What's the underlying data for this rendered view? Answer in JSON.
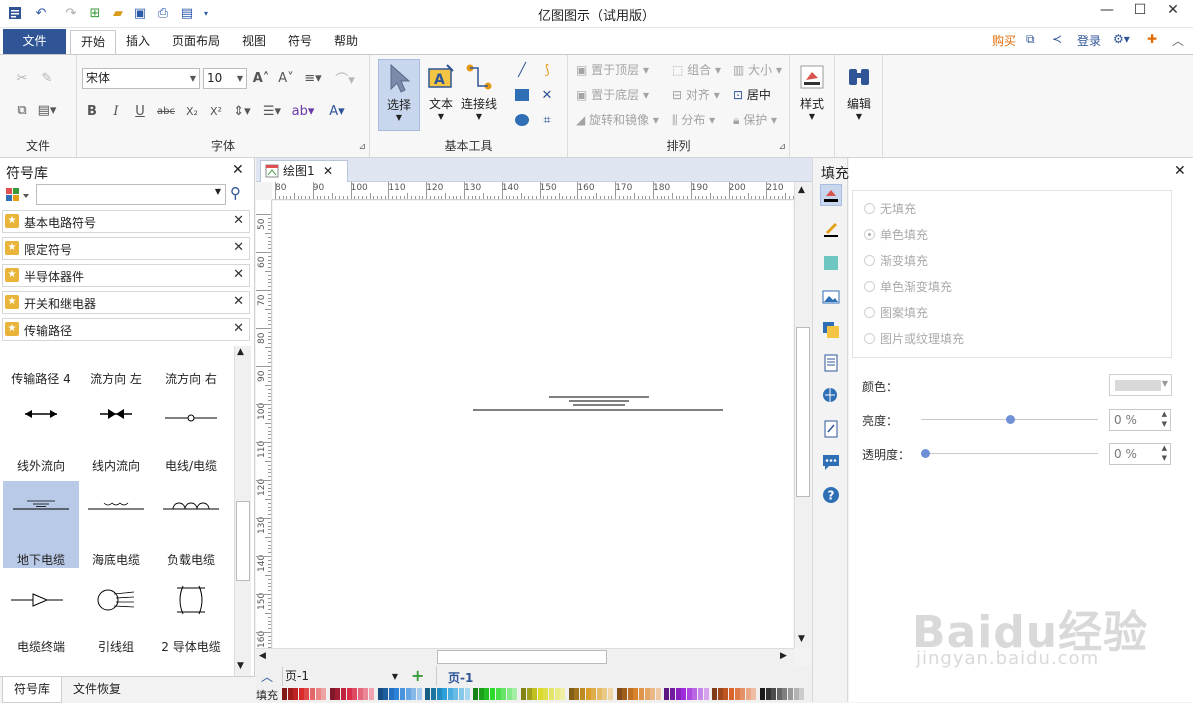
{
  "app": {
    "title": "亿图图示（试用版）"
  },
  "tabs": [
    "文件",
    "开始",
    "插入",
    "页面布局",
    "视图",
    "符号",
    "帮助"
  ],
  "active_tab": "开始",
  "top_right": {
    "buy": "购买",
    "login": "登录"
  },
  "ribbon": {
    "file_group": "文件",
    "font_group": "字体",
    "font_name": "宋体",
    "font_size": "10",
    "basic_tools_group": "基本工具",
    "select_label": "选择",
    "text_label": "文本",
    "connector_label": "连接线",
    "arrange_group": "排列",
    "bring_front": "置于顶层",
    "send_back": "置于底层",
    "rotate_mirror": "旋转和镜像",
    "group": "组合",
    "align": "对齐",
    "distribute": "分布",
    "size": "大小",
    "center": "居中",
    "protect": "保护",
    "style_label": "样式",
    "edit_label": "编辑"
  },
  "library": {
    "title": "符号库",
    "search_placeholder": "",
    "categories": [
      "基本电路符号",
      "限定符号",
      "半导体器件",
      "开关和继电器",
      "传输路径"
    ],
    "symbols": [
      {
        "name": "传输路径 4"
      },
      {
        "name": "流方向 左"
      },
      {
        "name": "流方向 右"
      },
      {
        "name": "线外流向"
      },
      {
        "name": "线内流向"
      },
      {
        "name": "电线/电缆"
      },
      {
        "name": "地下电缆"
      },
      {
        "name": "海底电缆"
      },
      {
        "name": "负载电缆"
      },
      {
        "name": "电缆终端"
      },
      {
        "name": "引线组"
      },
      {
        "name": "2 导体电缆"
      }
    ],
    "selected_symbol": "地下电缆"
  },
  "document": {
    "tab_name": "绘图1",
    "hruler_ticks": [
      "80",
      "90",
      "100",
      "110",
      "120",
      "130",
      "140",
      "150",
      "160",
      "170",
      "180",
      "190",
      "200",
      "210"
    ],
    "vruler_ticks": [
      "50",
      "60",
      "70",
      "80",
      "90",
      "100",
      "110",
      "120",
      "130",
      "140",
      "150",
      "160"
    ]
  },
  "fill_panel": {
    "title": "填充",
    "options": [
      "无填充",
      "单色填充",
      "渐变填充",
      "单色渐变填充",
      "图案填充",
      "图片或纹理填充"
    ],
    "selected_option": "单色填充",
    "color_label": "颜色：",
    "brightness_label": "亮度：",
    "brightness_value": "0 %",
    "transparency_label": "透明度：",
    "transparency_value": "0 %",
    "brightness_level": 0.5,
    "transparency_level": 0.0
  },
  "page_bar": {
    "page_selector": "页-1",
    "active_page": "页-1",
    "fill_label": "填充"
  },
  "left_bottom_tabs": [
    "符号库",
    "文件恢复"
  ],
  "watermark": {
    "brand": "Baidu经验",
    "url": "jingyan.baidu.com"
  },
  "colors": {
    "accent": "#2f5597",
    "buy": "#e36c09"
  }
}
